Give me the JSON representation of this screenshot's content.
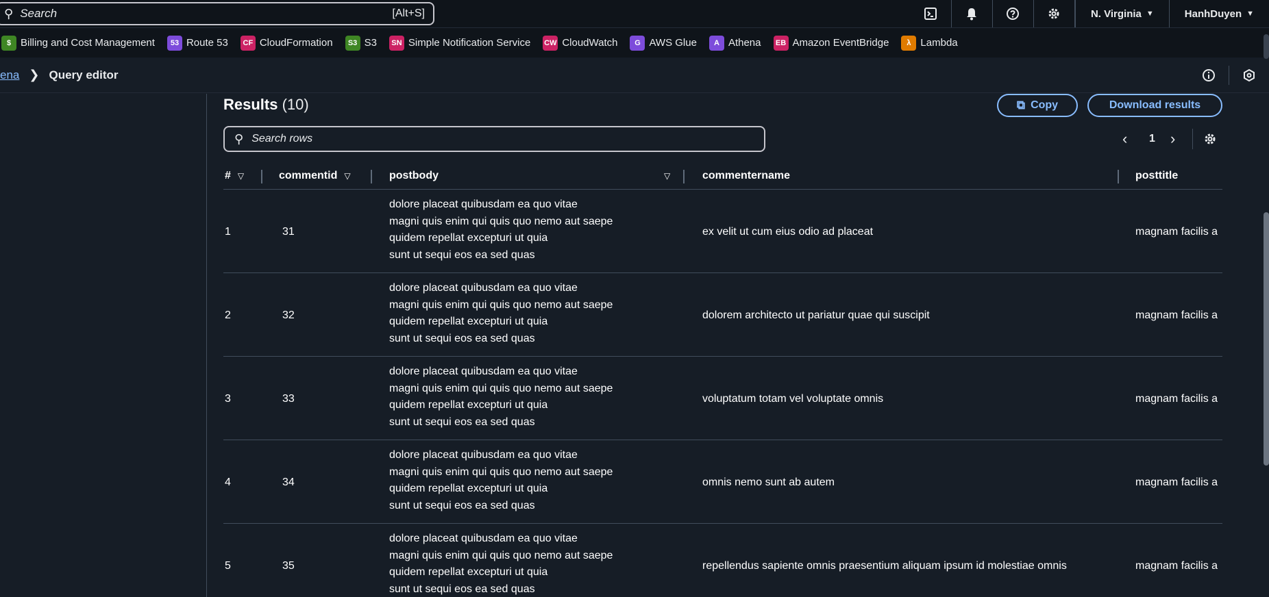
{
  "topbar": {
    "search_placeholder": "Search",
    "search_shortcut": "[Alt+S]",
    "region": "N. Virginia",
    "user": "HanhDuyen"
  },
  "favorites": [
    {
      "label": "Billing and Cost Management",
      "color": "#3f8624",
      "glyph": "$"
    },
    {
      "label": "Route 53",
      "color": "#7d4cdb",
      "glyph": "53"
    },
    {
      "label": "CloudFormation",
      "color": "#cc2264",
      "glyph": "CF"
    },
    {
      "label": "S3",
      "color": "#3f8624",
      "glyph": "S3"
    },
    {
      "label": "Simple Notification Service",
      "color": "#cc2264",
      "glyph": "SN"
    },
    {
      "label": "CloudWatch",
      "color": "#cc2264",
      "glyph": "CW"
    },
    {
      "label": "AWS Glue",
      "color": "#7d4cdb",
      "glyph": "G"
    },
    {
      "label": "Athena",
      "color": "#7d4cdb",
      "glyph": "A"
    },
    {
      "label": "Amazon EventBridge",
      "color": "#cc2264",
      "glyph": "EB"
    },
    {
      "label": "Lambda",
      "color": "#e07b00",
      "glyph": "λ"
    }
  ],
  "breadcrumb": {
    "parent": "ena",
    "current": "Query editor"
  },
  "results": {
    "title": "Results",
    "count": "(10)",
    "copy_label": "Copy",
    "download_label": "Download results",
    "search_placeholder": "Search rows",
    "page": "1"
  },
  "table": {
    "columns": [
      "#",
      "commentid",
      "postbody",
      "commentername",
      "posttitle"
    ],
    "rows": [
      {
        "num": "1",
        "commentid": "31",
        "postbody": "dolore placeat quibusdam ea quo vitae\nmagni quis enim qui quis quo nemo aut saepe\nquidem repellat excepturi ut quia\nsunt ut sequi eos ea sed quas",
        "commentername": "ex velit ut cum eius odio ad placeat",
        "posttitle": "magnam facilis a"
      },
      {
        "num": "2",
        "commentid": "32",
        "postbody": "dolore placeat quibusdam ea quo vitae\nmagni quis enim qui quis quo nemo aut saepe\nquidem repellat excepturi ut quia\nsunt ut sequi eos ea sed quas",
        "commentername": "dolorem architecto ut pariatur quae qui suscipit",
        "posttitle": "magnam facilis a"
      },
      {
        "num": "3",
        "commentid": "33",
        "postbody": "dolore placeat quibusdam ea quo vitae\nmagni quis enim qui quis quo nemo aut saepe\nquidem repellat excepturi ut quia\nsunt ut sequi eos ea sed quas",
        "commentername": "voluptatum totam vel voluptate omnis",
        "posttitle": "magnam facilis a"
      },
      {
        "num": "4",
        "commentid": "34",
        "postbody": "dolore placeat quibusdam ea quo vitae\nmagni quis enim qui quis quo nemo aut saepe\nquidem repellat excepturi ut quia\nsunt ut sequi eos ea sed quas",
        "commentername": "omnis nemo sunt ab autem",
        "posttitle": "magnam facilis a"
      },
      {
        "num": "5",
        "commentid": "35",
        "postbody": "dolore placeat quibusdam ea quo vitae\nmagni quis enim qui quis quo nemo aut saepe\nquidem repellat excepturi ut quia\nsunt ut sequi eos ea sed quas",
        "commentername": "repellendus sapiente omnis praesentium aliquam ipsum id molestiae omnis",
        "posttitle": "magnam facilis a"
      }
    ]
  }
}
